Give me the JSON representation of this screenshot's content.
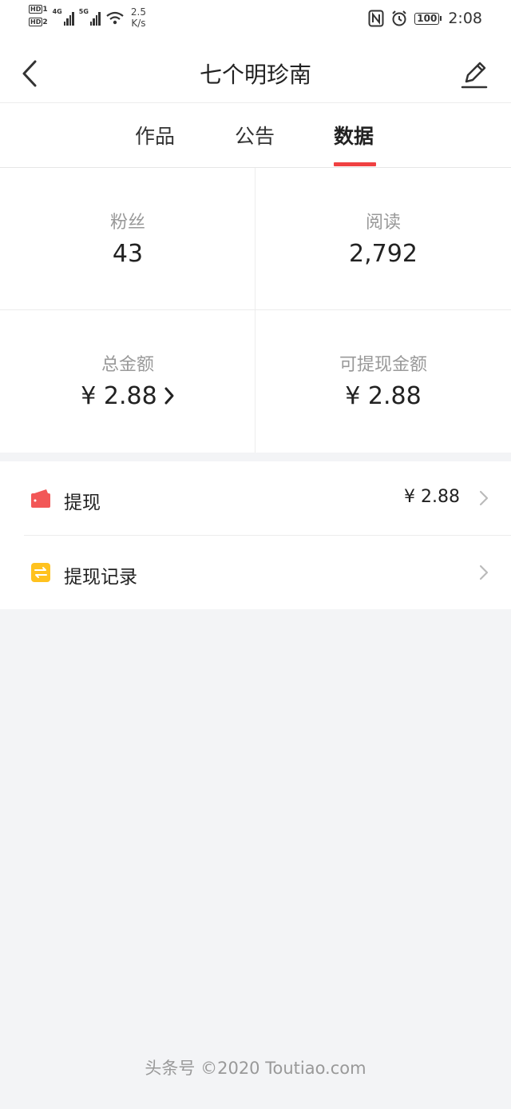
{
  "status_bar": {
    "hd1": "HD",
    "hd1_sub": "1",
    "hd2": "HD",
    "hd2_sub": "2",
    "net1": "4G",
    "net2": "5G",
    "speed_value": "2.5",
    "speed_unit": "K/s",
    "nfc_icon": "nfc-icon",
    "alarm_icon": "alarm-icon",
    "battery_level": "100",
    "time": "2:08"
  },
  "header": {
    "back_icon": "chevron-left-icon",
    "title": "七个明珍南",
    "edit_icon": "pencil-icon"
  },
  "tabs": [
    {
      "label": "作品",
      "active": false
    },
    {
      "label": "公告",
      "active": false
    },
    {
      "label": "数据",
      "active": true
    }
  ],
  "stats": {
    "fans_label": "粉丝",
    "fans_value": "43",
    "reads_label": "阅读",
    "reads_value": "2,792",
    "total_label": "总金额",
    "total_value": "¥ 2.88",
    "withdrawable_label": "可提现金额",
    "withdrawable_value": "¥ 2.88"
  },
  "list": {
    "withdraw": {
      "icon": "wallet-icon",
      "label": "提现",
      "amount": "¥ 2.88"
    },
    "records": {
      "icon": "record-icon",
      "label": "提现记录"
    }
  },
  "colors": {
    "accent": "#f04142",
    "wallet": "#f25757",
    "record": "#ffc21f",
    "background": "#f3f4f6"
  },
  "footer": "头条号 ©2020 Toutiao.com"
}
